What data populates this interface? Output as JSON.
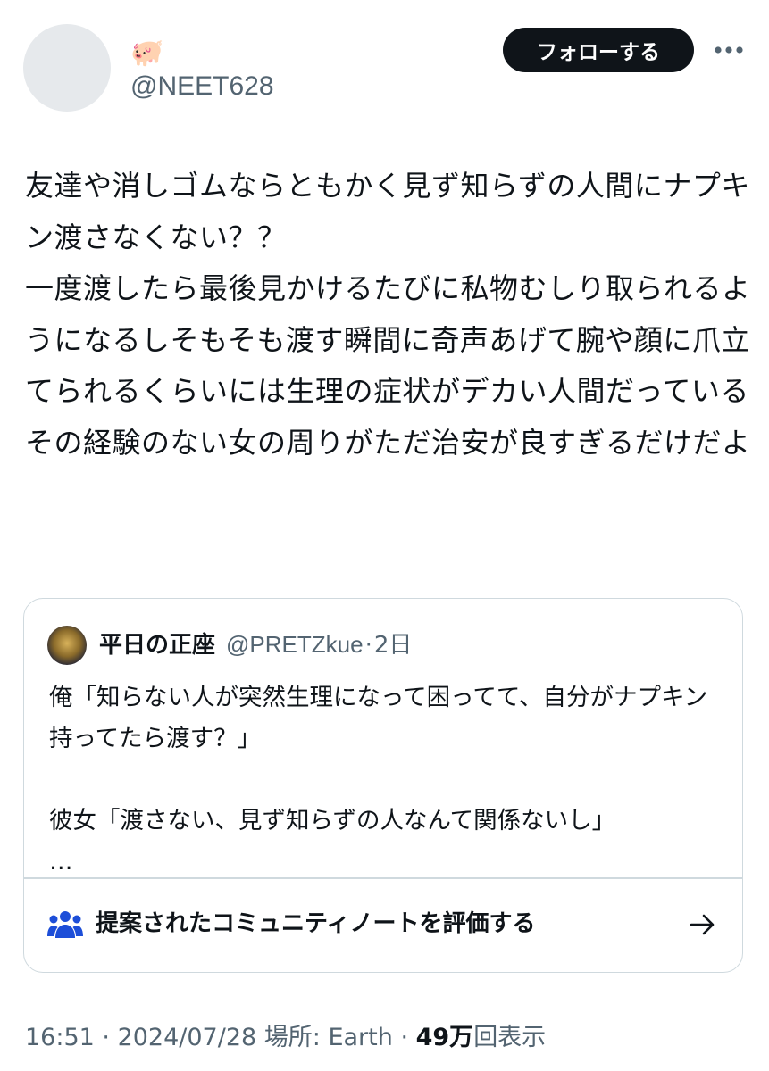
{
  "author": {
    "display_name": "🐖",
    "handle": "@NEET628"
  },
  "actions": {
    "follow_label": "フォローする",
    "more_icon": "more-horizontal-icon"
  },
  "tweet": {
    "text": "友達や消しゴムならともかく見ず知らずの人間にナプキン渡さなくない？？\n一度渡したら最後見かけるたびに私物むしり取られるようになるしそもそも渡す瞬間に奇声あげて腕や顔に爪立てられるくらいには生理の症状がデカい人間だっている\nその経験のない女の周りがただ治安が良すぎるだけだよ"
  },
  "quoted_tweet": {
    "display_name": "平日の正座",
    "handle": "@PRETZkue",
    "separator": "·",
    "time": "2日",
    "text": "俺「知らない人が突然生理になって困ってて、自分がナプキン持ってたら渡す？」\n\n彼女「渡さない、見ず知らずの人なんて関係ないし」\n…"
  },
  "community_note": {
    "label": "提案されたコミュニティノートを評価する",
    "icon": "people-icon",
    "arrow_icon": "arrow-right-icon"
  },
  "meta": {
    "time": "16:51",
    "sep1": " · ",
    "date": "2024/07/28",
    "location": " 場所: Earth",
    "sep2": " · ",
    "views_count": "49万",
    "views_label": "回表示"
  },
  "colors": {
    "text": "#0f1419",
    "secondary": "#536471",
    "border": "#cfd9de",
    "follow_bg": "#0f1419",
    "note_icon": "#1d4ed8"
  }
}
